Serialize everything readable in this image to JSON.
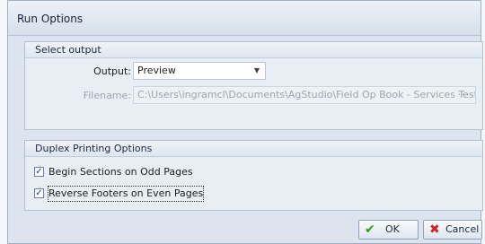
{
  "window": {
    "title": "Run Options"
  },
  "select_output": {
    "header": "Select output",
    "output_label": "Output:",
    "output_value": "Preview",
    "filename_label": "Filename:",
    "filename_value": "C:\\Users\\ingramcl\\Documents\\AgStudio\\Field Op Book - Services Testing.pdf",
    "browse_label": "···"
  },
  "duplex": {
    "header": "Duplex Printing Options",
    "options": [
      {
        "label": "Begin Sections on Odd Pages",
        "checked": true
      },
      {
        "label": "Reverse Footers on Even Pages",
        "checked": true
      }
    ]
  },
  "buttons": {
    "ok": "OK",
    "cancel": "Cancel"
  },
  "colors": {
    "ok_check": "#2f9a1f",
    "cancel_x": "#d2232a"
  }
}
